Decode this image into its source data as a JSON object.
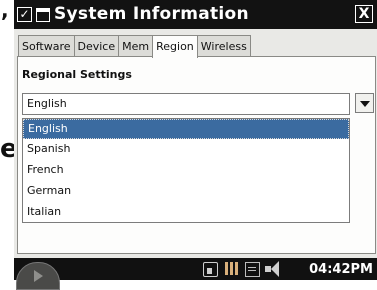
{
  "background_fragments": {
    "comma": ",",
    "letter": "e"
  },
  "window": {
    "title": "System Information",
    "close_symbol": "X",
    "check_symbol": "✓"
  },
  "tabs": [
    {
      "label": "Software",
      "active": false
    },
    {
      "label": "Device",
      "active": false
    },
    {
      "label": "Mem",
      "active": false
    },
    {
      "label": "Region",
      "active": true
    },
    {
      "label": "Wireless",
      "active": false
    }
  ],
  "region": {
    "section_title": "Regional Settings",
    "selected": "English",
    "options": [
      "English",
      "Spanish",
      "French",
      "German",
      "Italian"
    ],
    "highlighted_index": 0
  },
  "taskbar": {
    "clock": "04:42PM",
    "tray_icons": [
      "home-icon",
      "grid-icon",
      "keyboard-icon",
      "volume-icon"
    ]
  },
  "colors": {
    "titlebar": "#121212",
    "selection": "#3b6ba0",
    "window_bg": "#e9e9e6"
  }
}
